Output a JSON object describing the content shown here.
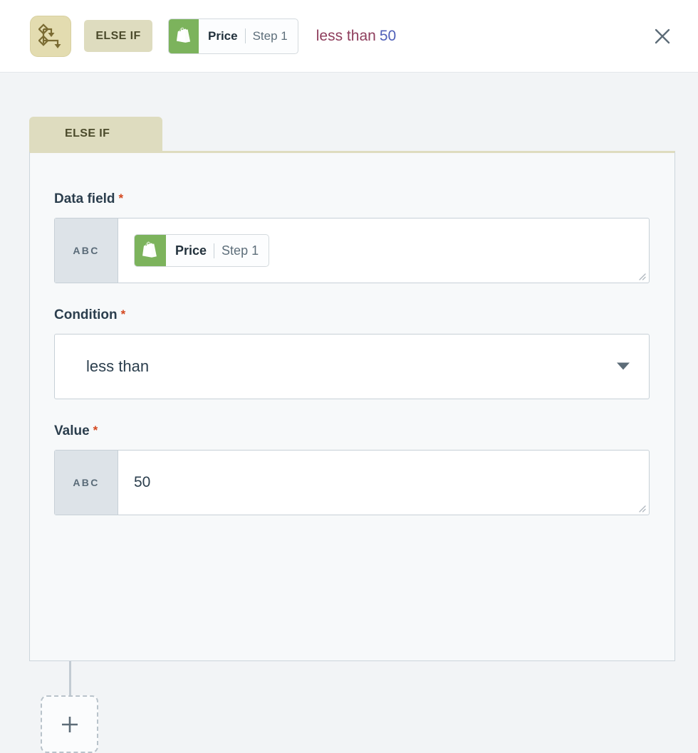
{
  "header": {
    "flow_icon": "branch-condition-icon",
    "tag_label": "ELSE IF",
    "token": {
      "app_icon": "shopify-icon",
      "name": "Price",
      "step": "Step 1"
    },
    "summary_operator": "less than",
    "summary_value": "50",
    "close_label": "close-icon"
  },
  "card": {
    "tab_label": "ELSE IF",
    "fields": {
      "data_field": {
        "label": "Data field",
        "required_marker": "*",
        "type_badge": "ABC",
        "token": {
          "app_icon": "shopify-icon",
          "name": "Price",
          "step": "Step 1"
        }
      },
      "condition": {
        "label": "Condition",
        "required_marker": "*",
        "value": "less than",
        "caret": "chevron-down-icon"
      },
      "value": {
        "label": "Value",
        "required_marker": "*",
        "type_badge": "ABC",
        "value": "50"
      }
    }
  },
  "add_node": {
    "label": "+",
    "name": "add-step-button"
  },
  "colors": {
    "accent_khaki": "#dedcbf",
    "shopify_green": "#7cb35c",
    "summary_operator": "#8e3d5c",
    "summary_value": "#5060b8",
    "required_red": "#d4481f",
    "body_bg": "#f2f4f6",
    "card_bg": "#f7f9fa"
  }
}
